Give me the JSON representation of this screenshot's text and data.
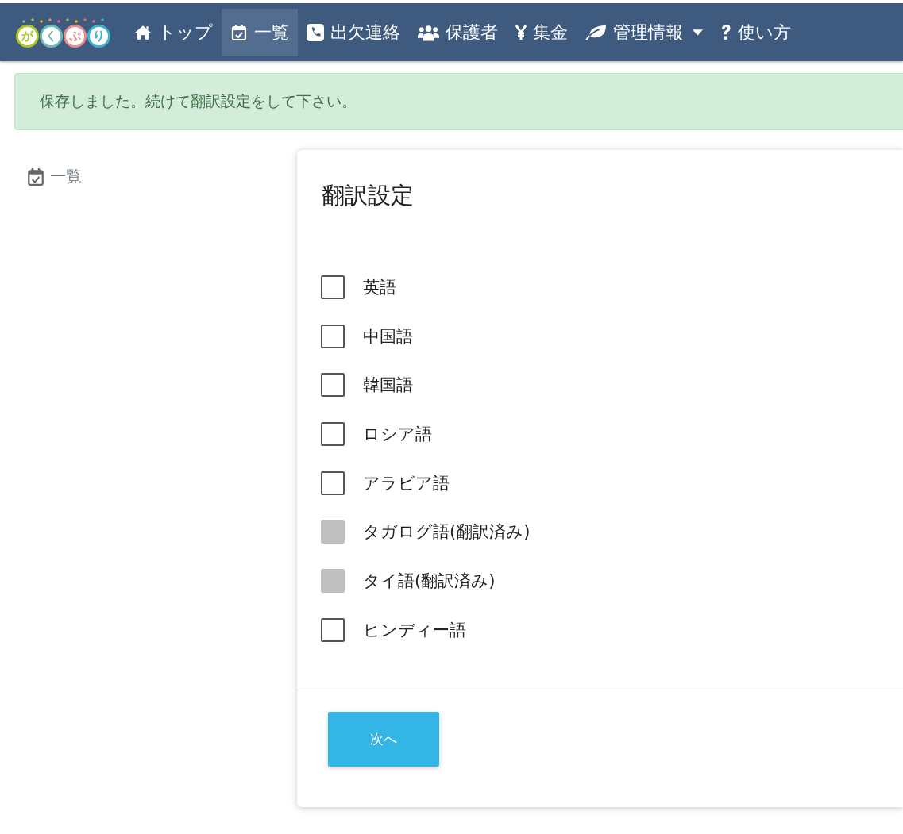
{
  "logo": {
    "letters": [
      {
        "char": "が",
        "color": "#a8c520"
      },
      {
        "char": "く",
        "color": "#6bbcb3"
      },
      {
        "char": "ぷ",
        "color": "#ef8a8a"
      },
      {
        "char": "り",
        "color": "#3bb3d0"
      }
    ]
  },
  "nav": [
    {
      "kind": "home",
      "label": "トップ",
      "selected": false
    },
    {
      "kind": "calendar",
      "label": "一覧",
      "selected": true
    },
    {
      "kind": "phone",
      "label": "出欠連絡",
      "selected": false
    },
    {
      "kind": "users",
      "label": "保護者",
      "selected": false
    },
    {
      "kind": "yen",
      "label": "集金",
      "selected": false
    },
    {
      "kind": "leaf",
      "label": "管理情報",
      "selected": false,
      "dropdown": true
    },
    {
      "kind": "question",
      "label": "使い方",
      "selected": false
    }
  ],
  "alert": "保存しました。続けて翻訳設定をして下さい。",
  "sidebar": {
    "label": "一覧"
  },
  "card": {
    "title": "翻訳設定",
    "options": [
      {
        "label": "英語",
        "checked": false,
        "disabled": false
      },
      {
        "label": "中国語",
        "checked": false,
        "disabled": false
      },
      {
        "label": "韓国語",
        "checked": false,
        "disabled": false
      },
      {
        "label": "ロシア語",
        "checked": false,
        "disabled": false
      },
      {
        "label": "アラビア語",
        "checked": false,
        "disabled": false
      },
      {
        "label": "タガログ語(翻訳済み)",
        "checked": false,
        "disabled": true
      },
      {
        "label": "タイ語(翻訳済み)",
        "checked": false,
        "disabled": true
      },
      {
        "label": "ヒンディー語",
        "checked": false,
        "disabled": false
      }
    ],
    "button": "次へ"
  }
}
